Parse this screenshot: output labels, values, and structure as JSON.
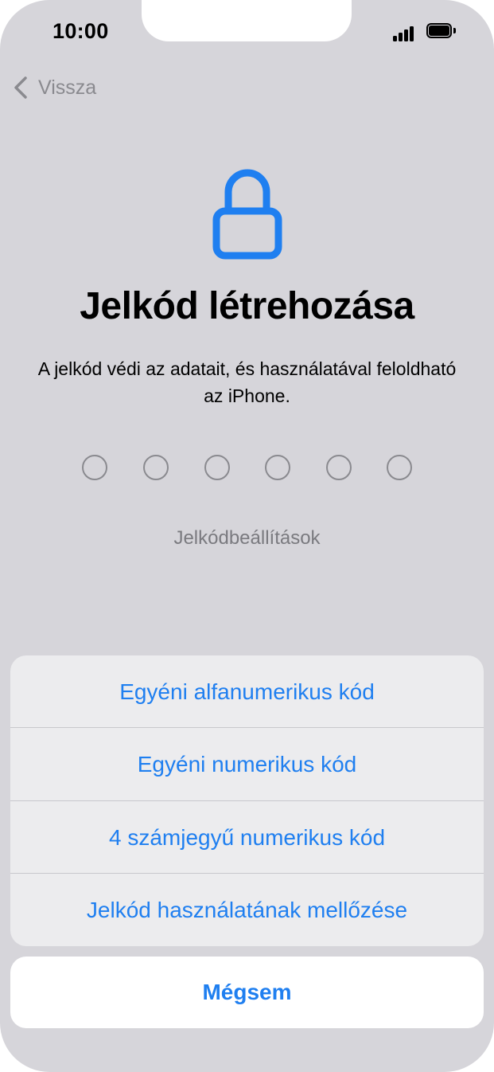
{
  "status_bar": {
    "time": "10:00",
    "icons": [
      "cellular-signal-icon",
      "battery-icon"
    ]
  },
  "nav": {
    "back_label": "Vissza",
    "back_icon": "chevron-left-icon"
  },
  "main": {
    "icon": "lock-icon",
    "title": "Jelkód létrehozása",
    "description": "A jelkód védi az adatait, és használatával feloldható az iPhone.",
    "passcode_digit_count": 6,
    "options_link": "Jelkódbeállítások"
  },
  "action_sheet": {
    "options": [
      {
        "label": "Egyéni alfanumerikus kód"
      },
      {
        "label": "Egyéni numerikus kód"
      },
      {
        "label": "4 számjegyű numerikus kód"
      },
      {
        "label": "Jelkód használatának mellőzése"
      }
    ],
    "cancel_label": "Mégsem"
  },
  "colors": {
    "accent": "#1f7ff0",
    "background": "#d6d5da",
    "sheet": "#ececee",
    "muted_text": "#8a8a8f"
  }
}
